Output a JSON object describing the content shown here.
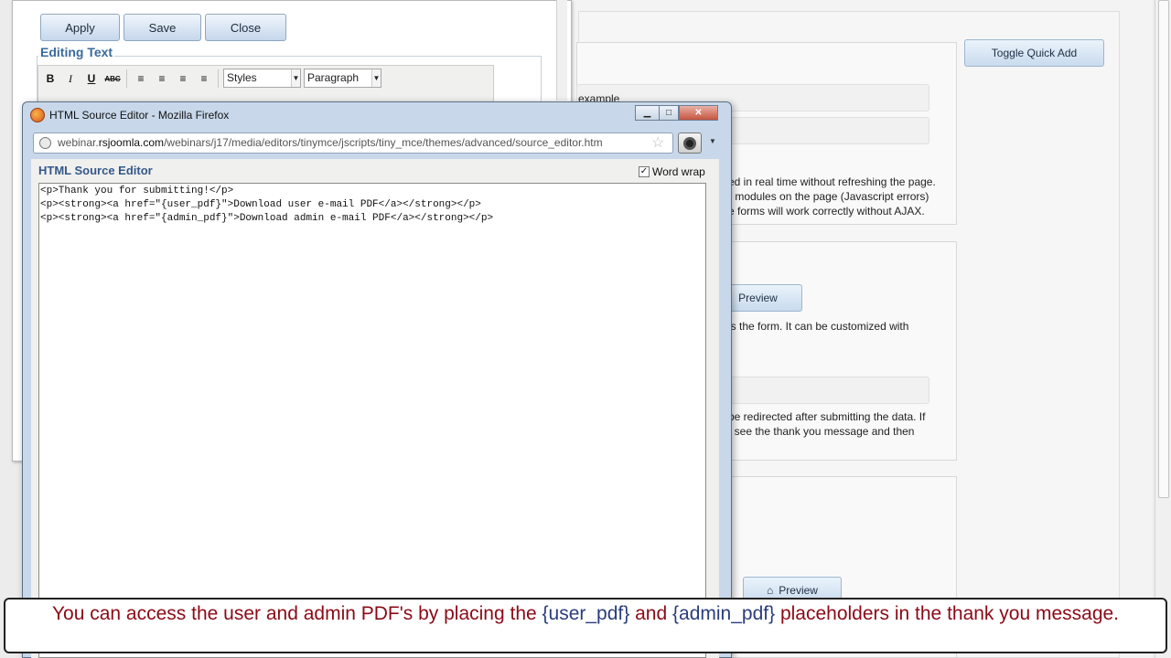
{
  "background": {
    "toggle_quick_add": "Toggle Quick Add",
    "example_text": "example",
    "desc_lines": [
      "ed in real time without refreshing the page.",
      "r modules on the page (Javascript errors)",
      "e forms will work correctly without AJAX."
    ],
    "preview1": "Preview",
    "form_text": "ls the form. It can be customized with",
    "redirect_lines": [
      "be redirected after submitting the data. If",
      "t see the thank you message and then"
    ],
    "preview2": "Preview"
  },
  "editor": {
    "apply": "Apply",
    "save": "Save",
    "close": "Close",
    "legend": "Editing Text",
    "toolbar": {
      "bold": "B",
      "italic": "I",
      "underline": "U",
      "strike": "ABC",
      "styles": "Styles",
      "paragraph": "Paragraph"
    }
  },
  "popup": {
    "title": "HTML Source Editor - Mozilla Firefox",
    "url_domain_prefix": "webinar.",
    "url_domain": "rsjoomla.com",
    "url_path": "/webinars/j17/media/editors/tinymce/jscripts/tiny_mce/themes/advanced/source_editor.htm",
    "heading": "HTML Source Editor",
    "word_wrap": "Word wrap",
    "word_wrap_checked": true,
    "lines": [
      "<p>Thank you for submitting!</p>",
      "<p><strong><a href=\"{user_pdf}\">Download user e-mail PDF</a></strong></p>",
      "<p><strong><a href=\"{admin_pdf}\">Download admin e-mail PDF</a></strong></p>"
    ]
  },
  "caption": {
    "part1": "You can access the user and admin PDF's by placing the ",
    "ph1": "{user_pdf}",
    "part2": " and ",
    "ph2": "{admin_pdf}",
    "part3": " placeholders in the thank you message."
  }
}
